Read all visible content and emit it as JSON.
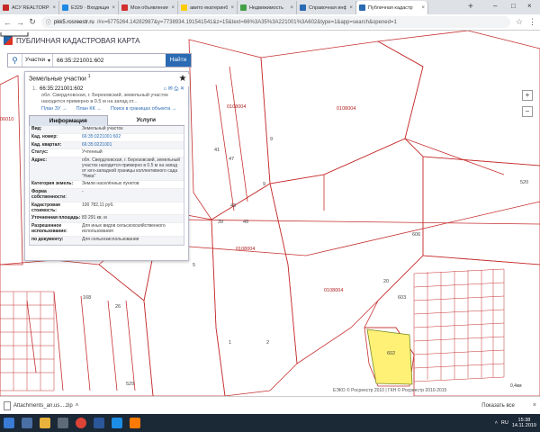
{
  "browser": {
    "tabs": [
      {
        "title": "АСУ REALTORPRO",
        "color": "#c62828",
        "active": false
      },
      {
        "title": "Е329 · Входящие",
        "color": "#1e88e5",
        "active": false
      },
      {
        "title": "Мои объявления",
        "color": "#d32f2f",
        "active": false
      },
      {
        "title": "авито екатеринбург",
        "color": "#ffcc00",
        "active": false
      },
      {
        "title": "Недвижимость",
        "color": "#43a047",
        "active": false
      },
      {
        "title": "Справочная инф",
        "color": "#2a6ab2",
        "active": false
      },
      {
        "title": "Публичная кадастр",
        "color": "#2a6ab2",
        "active": true
      }
    ],
    "new_tab": "+",
    "address_host": "pkk5.rosreestr.ru",
    "address_rest": "/#x=6775264.14282987&y=7738934.191541541&z=15&text=66%3A35%3A221001%3A602&type=1&app=search&opened=1"
  },
  "map": {
    "title": "ПУБЛИЧНАЯ КАДАСТРОВАЯ КАРТА",
    "attribution": "ЕЭКО © Росреестр 2010 | ГКН © Росреестр 2010-2015",
    "scale_label": "0,4км",
    "zoom_in": "+",
    "zoom_out": "−",
    "labels": {
      "q1": "0108004",
      "q2": "0108004",
      "q3": "0108004",
      "q4": "0108004",
      "n6010": "06010",
      "n9a": "9",
      "n9b": "9",
      "n47": "47",
      "n41": "41",
      "n43": "43",
      "n39": "39",
      "n49": "49",
      "n1": "1",
      "n2": "2",
      "n5": "5",
      "n20": "20",
      "n603": "603",
      "n606": "606",
      "n520": "520",
      "n602": "602",
      "n168": "168",
      "n529": "529",
      "n26": "26"
    },
    "highlight_color": "#fff176"
  },
  "search": {
    "type": "Участки",
    "value": "66:35:221001:602",
    "button": "Найти"
  },
  "card": {
    "heading": "Земельные участки",
    "count": "1",
    "item_number": "1.",
    "cadastral": "66:35:221001:602",
    "address_short": "обл. Свердловская, г. Березовский, земельный участок находится примерно в 0.5 м на запад от...",
    "link_plan_zu": "План ЗУ →",
    "link_plan_kk": "План КК →",
    "link_borders": "Поиск в границах объекта →",
    "tab_info": "Информация",
    "tab_services": "Услуги",
    "rows": [
      {
        "k": "Вид:",
        "v": "Земельный участок",
        "link": false
      },
      {
        "k": "Кад. номер:",
        "v": "66:35:0221001:602",
        "link": true
      },
      {
        "k": "Кад. квартал:",
        "v": "66:35:0221001",
        "link": true
      },
      {
        "k": "Статус:",
        "v": "Учтенный",
        "link": false
      },
      {
        "k": "Адрес:",
        "v": "обл. Свердловская, г. Березовский, земельный участок находится примерно в 0.5 м на запад от юго-западной границы коллективного сада \"Нива\"",
        "link": false
      },
      {
        "k": "Категория земель:",
        "v": "Земли населённых пунктов",
        "link": false
      },
      {
        "k": "Форма собственности:",
        "v": "-",
        "link": false
      },
      {
        "k": "Кадастровая стоимость:",
        "v": "100 782,11 руб.",
        "link": false
      },
      {
        "k": "Уточненная площадь:",
        "v": "83 291 кв. м",
        "link": false
      },
      {
        "k": "Разрешенное использование:",
        "v": "Для иных видов сельскохозяйственного использования",
        "link": false
      },
      {
        "k": "по документу:",
        "v": "Для сельхозиспользования",
        "link": false
      }
    ]
  },
  "downloads": {
    "file": "Attachments_an.us....zip",
    "show_all": "Показать все",
    "close": "×"
  },
  "taskbar": {
    "lang": "RU",
    "time": "15:38",
    "date": "14.11.2019"
  }
}
